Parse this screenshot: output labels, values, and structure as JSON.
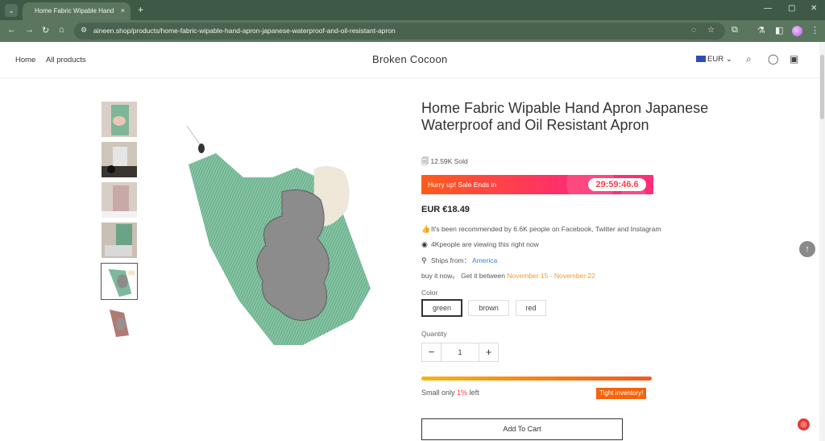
{
  "browser": {
    "tab_title": "Home Fabric Wipable Hand Apron",
    "tab_close": "×",
    "new_tab": "+",
    "url": "aineen.shop/products/home-fabric-wipable-hand-apron-japanese-waterproof-and-oil-resistant-apron",
    "window_controls": [
      "—",
      "▢",
      "✕"
    ]
  },
  "store": {
    "nav": [
      "Home",
      "All products"
    ],
    "brand": "Broken Cocoon",
    "currency": "EUR"
  },
  "product": {
    "title": "Home Fabric Wipable Hand Apron Japanese Waterproof and Oil Resistant Apron",
    "sold": "12.59K Sold",
    "sale_text": "Hurry up! Sale Ends in",
    "timer": "29:59:46.6",
    "price": "EUR €18.49",
    "recommend_text": "It's been recommended by 6.6K people on Facebook, Twitter and Instagram",
    "viewing_text": "4Kpeople are viewing this right now",
    "ships_label": "Ships from：",
    "ships_from": "America",
    "delivery_prefix": "buy it now。 Get it between",
    "delivery_range": "November 15 - November 22",
    "color_label": "Color",
    "colors": [
      "green",
      "brown",
      "red"
    ],
    "selected_color": "green",
    "quantity_label": "Quantity",
    "quantity": "1",
    "stock_prefix": "Small only",
    "stock_pct": "1%",
    "stock_suffix": "left",
    "stock_badge": "Tight inventory!",
    "add_to_cart": "Add To Cart"
  },
  "gallery": {
    "thumb_count": 6,
    "selected_index": 4
  },
  "colors": {
    "chrome_dark": "#3e5a47",
    "chrome_light": "#5b765f",
    "sale_gradient_start": "#ff5b1a",
    "sale_gradient_end": "#ff2d7a",
    "accent_orange": "#f39a2b",
    "link_blue": "#3b82d6"
  }
}
